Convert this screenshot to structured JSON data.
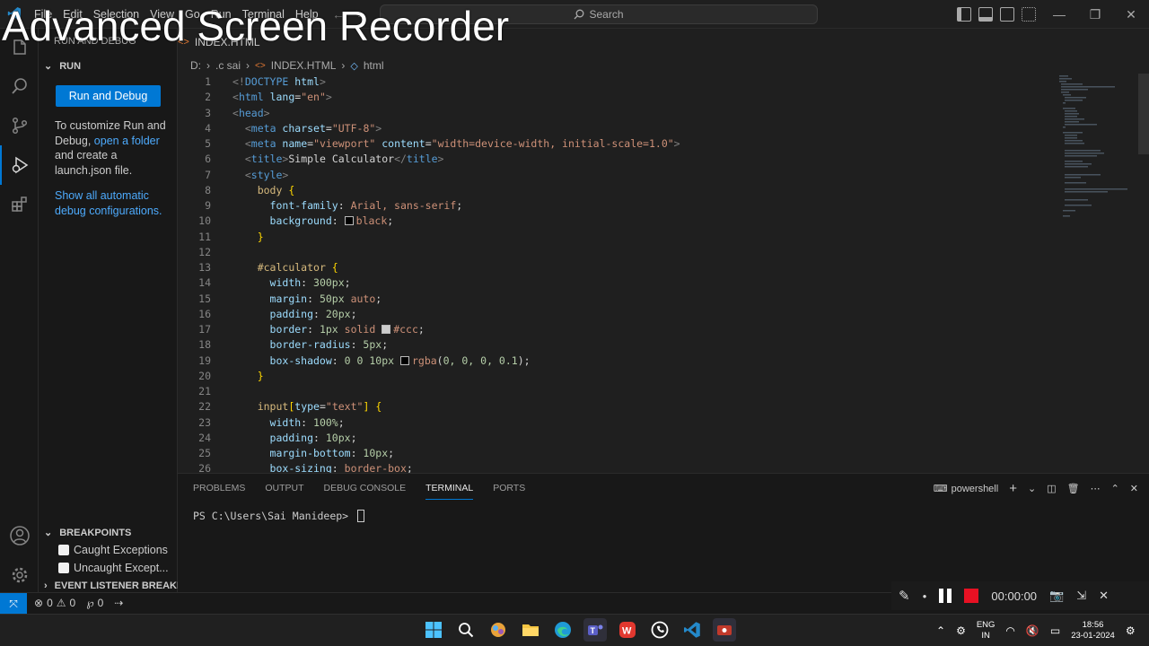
{
  "watermark": "Advanced Screen Recorder",
  "titlebar": {
    "menus": [
      "File",
      "Edit",
      "Selection",
      "View",
      "Go",
      "Run",
      "Terminal",
      "Help"
    ],
    "search_placeholder": "Search"
  },
  "partial_tab": "INDEX.HTML",
  "partial_sidebar_title": "RUN AND DEBUG",
  "sidebar": {
    "run_header": "RUN",
    "run_button": "Run and Debug",
    "desc_pre": "To customize Run and Debug,",
    "desc_link": "open a folder",
    "desc_post": "and create a launch.json file.",
    "show_auto": "Show all automatic debug configurations.",
    "breakpoints_header": "BREAKPOINTS",
    "breakpoints": [
      "Caught Exceptions",
      "Uncaught Except..."
    ],
    "event_header": "EVENT LISTENER BREAKPO..."
  },
  "breadcrumb": {
    "drive": "D:",
    "folder": ".c sai",
    "file": "INDEX.HTML",
    "symbol": "html"
  },
  "code_lines": [
    {
      "n": "1",
      "indent": "",
      "parts": [
        [
          "t-tag",
          "<!"
        ],
        [
          "t-el",
          "DOCTYPE"
        ],
        [
          "t-attr",
          " html"
        ],
        [
          "t-tag",
          ">"
        ]
      ]
    },
    {
      "n": "2",
      "indent": "",
      "parts": [
        [
          "t-tag",
          "<"
        ],
        [
          "t-el",
          "html"
        ],
        [
          "t-attr",
          " lang"
        ],
        [
          "",
          "="
        ],
        [
          "t-str",
          "\"en\""
        ],
        [
          "t-tag",
          ">"
        ]
      ]
    },
    {
      "n": "3",
      "indent": "",
      "parts": [
        [
          "t-tag",
          "<"
        ],
        [
          "t-el",
          "head"
        ],
        [
          "t-tag",
          ">"
        ]
      ]
    },
    {
      "n": "4",
      "indent": "  ",
      "parts": [
        [
          "t-tag",
          "<"
        ],
        [
          "t-el",
          "meta"
        ],
        [
          "t-attr",
          " charset"
        ],
        [
          "",
          "="
        ],
        [
          "t-str",
          "\"UTF-8\""
        ],
        [
          "t-tag",
          ">"
        ]
      ]
    },
    {
      "n": "5",
      "indent": "  ",
      "parts": [
        [
          "t-tag",
          "<"
        ],
        [
          "t-el",
          "meta"
        ],
        [
          "t-attr",
          " name"
        ],
        [
          "",
          "="
        ],
        [
          "t-str",
          "\"viewport\""
        ],
        [
          "t-attr",
          " content"
        ],
        [
          "",
          "="
        ],
        [
          "t-str",
          "\"width=device-width, initial-scale=1.0\""
        ],
        [
          "t-tag",
          ">"
        ]
      ]
    },
    {
      "n": "6",
      "indent": "  ",
      "parts": [
        [
          "t-tag",
          "<"
        ],
        [
          "t-el",
          "title"
        ],
        [
          "t-tag",
          ">"
        ],
        [
          "",
          "Simple Calculator"
        ],
        [
          "t-tag",
          "</"
        ],
        [
          "t-el",
          "title"
        ],
        [
          "t-tag",
          ">"
        ]
      ]
    },
    {
      "n": "7",
      "indent": "  ",
      "parts": [
        [
          "t-tag",
          "<"
        ],
        [
          "t-el",
          "style"
        ],
        [
          "t-tag",
          ">"
        ]
      ]
    },
    {
      "n": "8",
      "indent": "    ",
      "parts": [
        [
          "t-sel",
          "body"
        ],
        [
          "t-br",
          " {"
        ]
      ]
    },
    {
      "n": "9",
      "indent": "      ",
      "parts": [
        [
          "t-prop",
          "font-family"
        ],
        [
          "",
          ": "
        ],
        [
          "t-val",
          "Arial, sans-serif"
        ],
        [
          "",
          ";"
        ]
      ]
    },
    {
      "n": "10",
      "indent": "      ",
      "parts": [
        [
          "t-prop",
          "background"
        ],
        [
          "",
          ": "
        ],
        [
          "swatch",
          "#000000"
        ],
        [
          "t-val",
          "black"
        ],
        [
          "",
          ";"
        ]
      ]
    },
    {
      "n": "11",
      "indent": "    ",
      "parts": [
        [
          "t-br",
          "}"
        ]
      ]
    },
    {
      "n": "12",
      "indent": "",
      "parts": []
    },
    {
      "n": "13",
      "indent": "    ",
      "parts": [
        [
          "t-sel",
          "#calculator"
        ],
        [
          "t-br",
          " {"
        ]
      ]
    },
    {
      "n": "14",
      "indent": "      ",
      "parts": [
        [
          "t-prop",
          "width"
        ],
        [
          "",
          ": "
        ],
        [
          "t-num",
          "300px"
        ],
        [
          "",
          ";"
        ]
      ]
    },
    {
      "n": "15",
      "indent": "      ",
      "parts": [
        [
          "t-prop",
          "margin"
        ],
        [
          "",
          ": "
        ],
        [
          "t-num",
          "50px"
        ],
        [
          "t-val",
          " auto"
        ],
        [
          "",
          ";"
        ]
      ]
    },
    {
      "n": "16",
      "indent": "      ",
      "parts": [
        [
          "t-prop",
          "padding"
        ],
        [
          "",
          ": "
        ],
        [
          "t-num",
          "20px"
        ],
        [
          "",
          ";"
        ]
      ]
    },
    {
      "n": "17",
      "indent": "      ",
      "parts": [
        [
          "t-prop",
          "border"
        ],
        [
          "",
          ": "
        ],
        [
          "t-num",
          "1px"
        ],
        [
          "t-val",
          " solid "
        ],
        [
          "swatch",
          "#cccccc"
        ],
        [
          "t-val",
          "#ccc"
        ],
        [
          "",
          ";"
        ]
      ]
    },
    {
      "n": "18",
      "indent": "      ",
      "parts": [
        [
          "t-prop",
          "border-radius"
        ],
        [
          "",
          ": "
        ],
        [
          "t-num",
          "5px"
        ],
        [
          "",
          ";"
        ]
      ]
    },
    {
      "n": "19",
      "indent": "      ",
      "parts": [
        [
          "t-prop",
          "box-shadow"
        ],
        [
          "",
          ": "
        ],
        [
          "t-num",
          "0 0 10px "
        ],
        [
          "swatch",
          "#000000"
        ],
        [
          "t-val",
          "rgba"
        ],
        [
          "",
          "("
        ],
        [
          "t-num",
          "0, 0, 0, 0.1"
        ],
        [
          "",
          ");"
        ]
      ]
    },
    {
      "n": "20",
      "indent": "    ",
      "parts": [
        [
          "t-br",
          "}"
        ]
      ]
    },
    {
      "n": "21",
      "indent": "",
      "parts": []
    },
    {
      "n": "22",
      "indent": "    ",
      "parts": [
        [
          "t-sel",
          "input"
        ],
        [
          "t-br",
          "["
        ],
        [
          "t-attr",
          "type"
        ],
        [
          "",
          "="
        ],
        [
          "t-str",
          "\"text\""
        ],
        [
          "t-br",
          "]"
        ],
        [
          "t-br",
          " {"
        ]
      ]
    },
    {
      "n": "23",
      "indent": "      ",
      "parts": [
        [
          "t-prop",
          "width"
        ],
        [
          "",
          ": "
        ],
        [
          "t-num",
          "100%"
        ],
        [
          "",
          ";"
        ]
      ]
    },
    {
      "n": "24",
      "indent": "      ",
      "parts": [
        [
          "t-prop",
          "padding"
        ],
        [
          "",
          ": "
        ],
        [
          "t-num",
          "10px"
        ],
        [
          "",
          ";"
        ]
      ]
    },
    {
      "n": "25",
      "indent": "      ",
      "parts": [
        [
          "t-prop",
          "margin-bottom"
        ],
        [
          "",
          ": "
        ],
        [
          "t-num",
          "10px"
        ],
        [
          "",
          ";"
        ]
      ]
    },
    {
      "n": "26",
      "indent": "      ",
      "parts": [
        [
          "t-prop",
          "box-sizing"
        ],
        [
          "",
          ": "
        ],
        [
          "t-val",
          "border-box"
        ],
        [
          "",
          ";"
        ]
      ]
    }
  ],
  "panel": {
    "tabs": [
      "PROBLEMS",
      "OUTPUT",
      "DEBUG CONSOLE",
      "TERMINAL",
      "PORTS"
    ],
    "active_tab": "TERMINAL",
    "shell": "powershell",
    "prompt": "PS C:\\Users\\Sai Manideep> "
  },
  "statusbar": {
    "errors": "0",
    "warnings": "0",
    "ports": "0"
  },
  "recorder": {
    "time": "00:00:00"
  },
  "taskbar": {
    "lang_top": "ENG",
    "lang_bottom": "IN",
    "time": "18:56",
    "date": "23-01-2024"
  },
  "colors": {
    "accent": "#0078d4",
    "record": "#e81123"
  }
}
